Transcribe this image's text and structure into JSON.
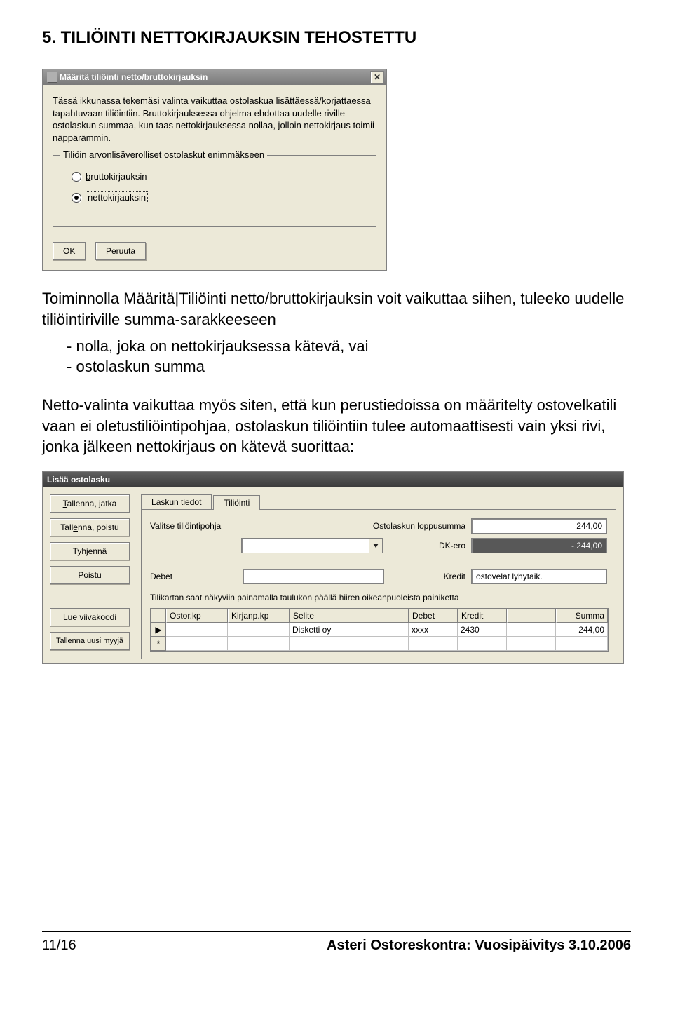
{
  "heading": "5. TILIÖINTI NETTOKIRJAUKSIN TEHOSTETTU",
  "para1": "Toiminnolla Määritä|Tiliöinti netto/bruttokirjauksin voit vaikuttaa siihen, tuleeko uudelle tiliöintiriville summa-sarakkeeseen",
  "bullets": {
    "b1": "nolla, joka on nettokirjauksessa kätevä, vai",
    "b2": "ostolaskun summa"
  },
  "para2": "Netto-valinta vaikuttaa myös siten, että kun perustiedoissa on määritelty ostovelkatili vaan ei oletustiliöintipohjaa, ostolaskun tiliöintiin tulee automaattisesti vain yksi rivi, jonka jälkeen nettokirjaus on kätevä suorittaa:",
  "dlg1": {
    "title": "Määritä tiliöinti netto/bruttokirjauksin",
    "desc": "Tässä ikkunassa tekemäsi valinta vaikuttaa ostolaskua lisättäessä/korjattaessa tapahtuvaan tiliöintiin. Bruttokirjauksessa ohjelma ehdottaa uudelle riville ostolaskun summaa, kun taas nettokirjauksessa nollaa, jolloin nettokirjaus toimii näppärämmin.",
    "group_title": "Tiliöin arvonlisäverolliset ostolaskut enimmäkseen",
    "radio_brutto_pre": "b",
    "radio_brutto": "ruttokirjauksin",
    "radio_netto_pre": "n",
    "radio_netto": "ettokirjauksin",
    "ok_u": "O",
    "ok_rest": "K",
    "cancel_u": "P",
    "cancel_rest": "eruuta"
  },
  "dlg2": {
    "title": "Lisää ostolasku",
    "sidebtns": {
      "b1_u": "T",
      "b1": "allenna, jatka",
      "b2": "Tallenna, poistu",
      "b2_u": "e",
      "b2_rest_before": "Tall",
      "b2_rest_after": "nna, poistu",
      "b3_u": "y",
      "b3_before": "T",
      "b3_after": "hjennä",
      "b4_u": "P",
      "b4_rest": "oistu",
      "b5_u": "v",
      "b5_before": "Lue ",
      "b5_after": "iivakoodi",
      "b6_u": "m",
      "b6_before": "Tallenna uusi ",
      "b6_after": "yyjä"
    },
    "tabs": {
      "t1_u": "L",
      "t1_rest": "askun tiedot",
      "t2": "Tiliöinti"
    },
    "labels": {
      "valitse": "Valitse tiliöintipohja",
      "loppusumma": "Ostolaskun loppusumma",
      "dkero": "DK-ero",
      "debet": "Debet",
      "kredit": "Kredit",
      "hint": "Tilikartan saat näkyviin painamalla taulukon päällä hiiren oikeanpuoleista painiketta"
    },
    "values": {
      "loppusumma": "244,00",
      "dkero": "- 244,00",
      "kredit_field": "ostovelat lyhytaik."
    },
    "grid": {
      "headers": {
        "ostor": "Ostor.kp",
        "kirj": "Kirjanp.kp",
        "selite": "Selite",
        "debet": "Debet",
        "kredit": "Kredit",
        "summa": "Summa"
      },
      "row1": {
        "selite": "Disketti oy",
        "debet": "xxxx",
        "kredit": "2430",
        "summa": "244,00"
      },
      "row_marker": "▶",
      "star": "*"
    }
  },
  "footer": {
    "left": "11/16",
    "right": "Asteri Ostoreskontra: Vuosipäivitys 3.10.2006"
  }
}
